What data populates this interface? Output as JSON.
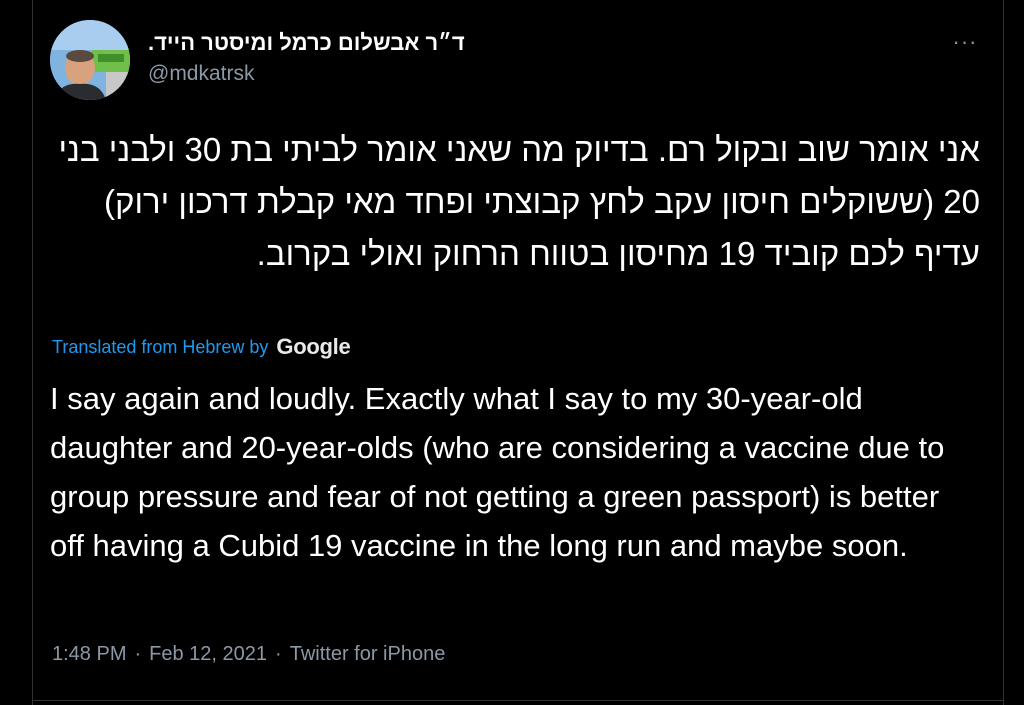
{
  "tweet": {
    "display_name": "ד״ר אבשלום כרמל ומיסטר הייד.",
    "handle": "@mdkatrsk",
    "more_label": "···",
    "text_hebrew": "אני אומר שוב ובקול רם. בדיוק מה שאני אומר לביתי בת 30 ולבני בני 20 (ששוקלים חיסון עקב לחץ קבוצתי ופחד מאי קבלת דרכון ירוק) עדיף לכם קוביד 19 מחיסון בטווח הרחוק ואולי בקרוב.",
    "translation": {
      "label": "Translated from Hebrew by",
      "provider": "Google"
    },
    "text_english": "I say again and loudly. Exactly what I say to my 30-year-old daughter and 20-year-olds (who are considering a vaccine due to group pressure and fear of not getting a green passport) is better off having a Cubid 19 vaccine in the long run and maybe soon.",
    "time": "1:48 PM",
    "date": "Feb 12, 2021",
    "source": "Twitter for iPhone",
    "separator": "·"
  },
  "colors": {
    "background": "#000000",
    "text": "#ffffff",
    "secondary": "#8b98a5",
    "link": "#1d9bf0",
    "border": "#2f3336"
  }
}
